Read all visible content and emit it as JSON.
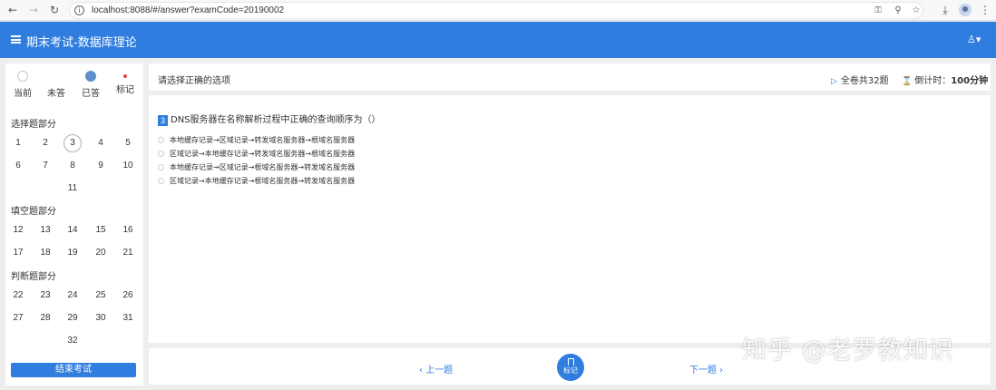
{
  "browser": {
    "url": "localhost:8088/#/answer?examCode=20190002",
    "back_icon": "←",
    "forward_icon": "→",
    "reload_icon": "↻",
    "info_icon": "i"
  },
  "header": {
    "title": "期末考试-数据库理论",
    "user_icon": "♙▾"
  },
  "sidebar": {
    "legend": [
      {
        "label": "当前"
      },
      {
        "label": "未答"
      },
      {
        "label": "已答"
      },
      {
        "label": "标记"
      }
    ],
    "sections": [
      {
        "title": "选择题部分",
        "numbers": [
          "1",
          "2",
          "3",
          "4",
          "5",
          "6",
          "7",
          "8",
          "9",
          "10",
          "11"
        ]
      },
      {
        "title": "填空题部分",
        "numbers": [
          "12",
          "13",
          "14",
          "15",
          "16",
          "17",
          "18",
          "19",
          "20",
          "21"
        ]
      },
      {
        "title": "判断题部分",
        "numbers": [
          "22",
          "23",
          "24",
          "25",
          "26",
          "27",
          "28",
          "29",
          "30",
          "31",
          "32"
        ]
      }
    ],
    "current_question": "3",
    "submit_label": "结束考试"
  },
  "main": {
    "instruction": "请选择正确的选项",
    "total": "全卷共32题",
    "countdown_label": "倒计时：",
    "countdown_value": "100分钟",
    "question": {
      "index": "3",
      "stem": "DNS服务器在名称解析过程中正确的查询顺序为（）",
      "options": [
        "本地缓存记录→区域记录→转发域名服务器→根域名服务器",
        "区域记录→本地缓存记录→转发域名服务器→根域名服务器",
        "本地缓存记录→区域记录→根域名服务器→转发域名服务器",
        "区域记录→本地缓存记录→根域名服务器→转发域名服务器"
      ]
    },
    "prev_label": "上一题",
    "next_label": "下一题",
    "flag_label": "标记"
  },
  "watermark": "知乎 @老罗教知识",
  "colors": {
    "primary": "#2f7ddf",
    "answered": "#5f8fcc",
    "flag_dot": "#e04545"
  }
}
